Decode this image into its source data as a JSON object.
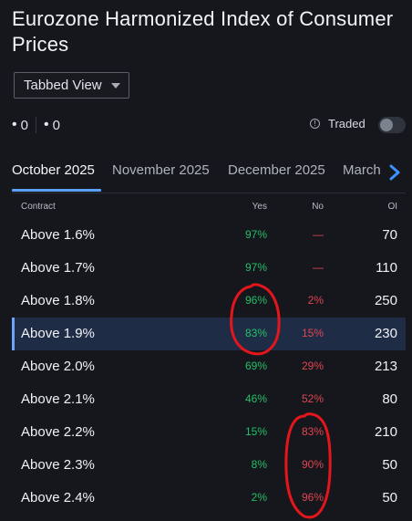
{
  "header": {
    "title": "Eurozone Harmonized Index of Consumer Prices"
  },
  "view_select": {
    "label": "Tabbed View"
  },
  "counts": {
    "left": "0",
    "right": "0"
  },
  "traded": {
    "label": "Traded"
  },
  "tabs": [
    {
      "label": "October 2025"
    },
    {
      "label": "November 2025"
    },
    {
      "label": "December 2025"
    },
    {
      "label": "March"
    }
  ],
  "table": {
    "headers": {
      "contract": "Contract",
      "yes": "Yes",
      "no": "No",
      "oi": "OI"
    },
    "rows": [
      {
        "contract": "Above 1.6%",
        "yes": "97%",
        "no": "—",
        "oi": "70"
      },
      {
        "contract": "Above 1.7%",
        "yes": "97%",
        "no": "—",
        "oi": "110"
      },
      {
        "contract": "Above 1.8%",
        "yes": "96%",
        "no": "2%",
        "oi": "250"
      },
      {
        "contract": "Above 1.9%",
        "yes": "83%",
        "no": "15%",
        "oi": "230"
      },
      {
        "contract": "Above 2.0%",
        "yes": "69%",
        "no": "29%",
        "oi": "213"
      },
      {
        "contract": "Above 2.1%",
        "yes": "46%",
        "no": "52%",
        "oi": "80"
      },
      {
        "contract": "Above 2.2%",
        "yes": "15%",
        "no": "83%",
        "oi": "210"
      },
      {
        "contract": "Above 2.3%",
        "yes": "8%",
        "no": "90%",
        "oi": "50"
      },
      {
        "contract": "Above 2.4%",
        "yes": "2%",
        "no": "96%",
        "oi": "50"
      }
    ]
  },
  "colors": {
    "background": "#15171d",
    "accent": "#5aa0ff",
    "yes": "#25bf67",
    "no": "#e04551",
    "highlight_row": "#1f2c46",
    "annotation": "#e3161c"
  },
  "icons": [
    "info-icon",
    "chevron-right-icon",
    "caret-down-icon"
  ]
}
